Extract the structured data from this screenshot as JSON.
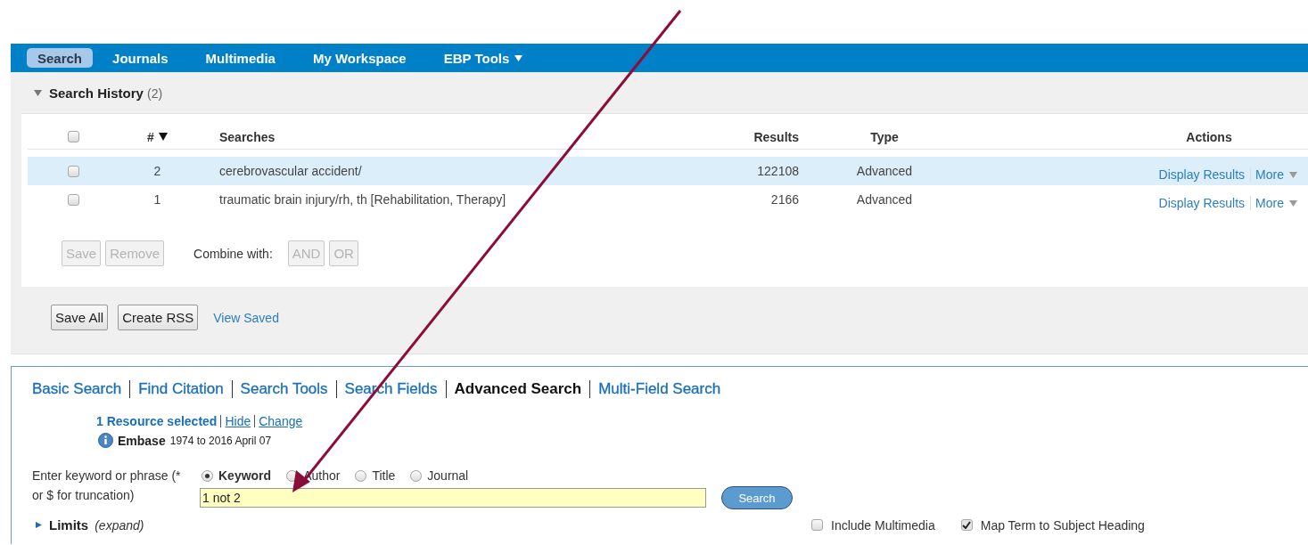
{
  "nav": {
    "tabs": [
      {
        "label": "Search",
        "selected": true,
        "dropdown": false
      },
      {
        "label": "Journals",
        "selected": false,
        "dropdown": false
      },
      {
        "label": "Multimedia",
        "selected": false,
        "dropdown": false
      },
      {
        "label": "My Workspace",
        "selected": false,
        "dropdown": false
      },
      {
        "label": "EBP Tools",
        "selected": false,
        "dropdown": true
      }
    ]
  },
  "history": {
    "title": "Search History",
    "count": "(2)",
    "expanded": true,
    "columns": {
      "number": "#",
      "searches": "Searches",
      "results": "Results",
      "type": "Type",
      "actions": "Actions"
    },
    "select_all": {
      "checked": false
    },
    "rows": [
      {
        "number": "2",
        "search": "cerebrovascular accident/",
        "results": "122108",
        "type": "Advanced",
        "selected": true,
        "checked": false,
        "display": "Display Results",
        "more": "More"
      },
      {
        "number": "1",
        "search": "traumatic brain injury/rh, th [Rehabilitation, Therapy]",
        "results": "2166",
        "type": "Advanced",
        "selected": false,
        "checked": false,
        "display": "Display Results",
        "more": "More"
      }
    ],
    "row_buttons": [
      {
        "label": "Save",
        "disabled": true
      },
      {
        "label": "Remove",
        "disabled": true
      }
    ],
    "combine_label": "Combine with:",
    "combine_buttons": [
      {
        "label": "AND",
        "disabled": true
      },
      {
        "label": "OR",
        "disabled": true
      }
    ],
    "footer_buttons": [
      "Save All",
      "Create RSS"
    ],
    "view_saved": "View Saved"
  },
  "search": {
    "tabs": [
      {
        "label": "Basic Search",
        "selected": false
      },
      {
        "label": "Find Citation",
        "selected": false
      },
      {
        "label": "Search Tools",
        "selected": false
      },
      {
        "label": "Search Fields",
        "selected": false
      },
      {
        "label": "Advanced Search",
        "selected": true
      },
      {
        "label": "Multi-Field Search",
        "selected": false
      }
    ],
    "resources": {
      "selected": "1 Resource selected",
      "links": [
        "Hide",
        "Change"
      ]
    },
    "database": {
      "name": "Embase",
      "coverage": "1974 to 2016 April 07"
    },
    "field_label": "Enter keyword or phrase (* or $ for truncation)",
    "modes": [
      {
        "label": "Keyword",
        "selected": true
      },
      {
        "label": "Author",
        "selected": false
      },
      {
        "label": "Title",
        "selected": false
      },
      {
        "label": "Journal",
        "selected": false
      }
    ],
    "query": "1 not 2",
    "search_button": "Search",
    "limits": {
      "label": "Limits",
      "hint": "(expand)",
      "expanded": false
    },
    "options": [
      {
        "label": "Include Multimedia",
        "checked": false
      },
      {
        "label": "Map Term to Subject Heading",
        "checked": true
      }
    ]
  }
}
